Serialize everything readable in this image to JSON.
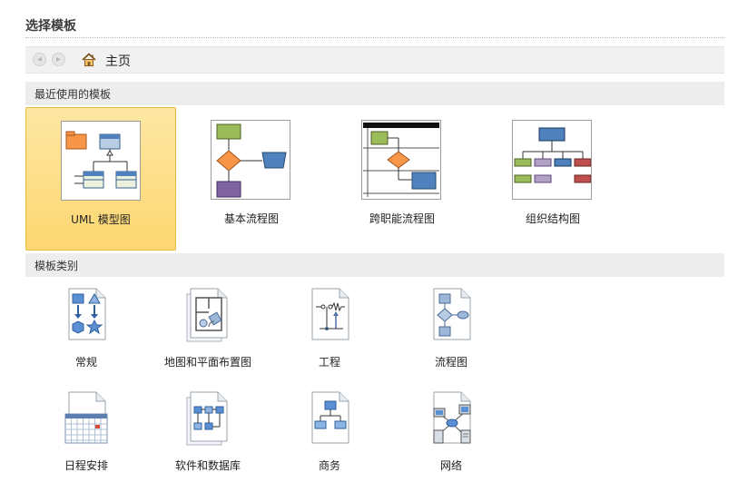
{
  "header": {
    "title": "选择模板"
  },
  "nav": {
    "home_label": "主页"
  },
  "recent": {
    "heading": "最近使用的模板",
    "items": [
      {
        "label": "UML 模型图",
        "selected": true
      },
      {
        "label": "基本流程图",
        "selected": false
      },
      {
        "label": "跨职能流程图",
        "selected": false
      },
      {
        "label": "组织结构图",
        "selected": false
      }
    ]
  },
  "categories": {
    "heading": "模板类别",
    "items": [
      {
        "label": "常规"
      },
      {
        "label": "地图和平面布置图"
      },
      {
        "label": "工程"
      },
      {
        "label": "流程图"
      },
      {
        "label": "日程安排"
      },
      {
        "label": "软件和数据库"
      },
      {
        "label": "商务"
      },
      {
        "label": "网络"
      }
    ]
  },
  "colors": {
    "selected_bg": "#fdd770",
    "orange": "#f79646",
    "blue": "#4f81bd",
    "green": "#9bbb59",
    "purple": "#8064a2",
    "red": "#c0504d"
  }
}
